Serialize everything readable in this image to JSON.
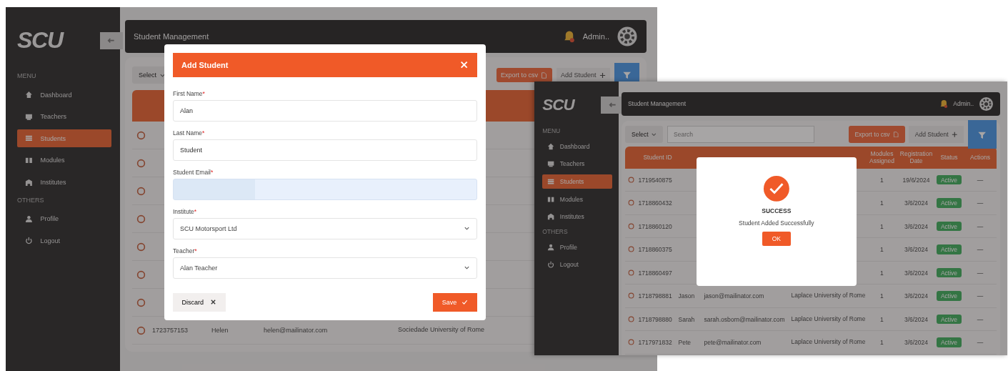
{
  "screens": [
    {
      "sidebar": {
        "logo": "SCU",
        "sections": [
          {
            "label": "MENU",
            "items": [
              {
                "label": "Dashboard",
                "selected": false
              },
              {
                "label": "Teachers",
                "selected": false
              },
              {
                "label": "Students",
                "selected": true
              },
              {
                "label": "Modules",
                "selected": false
              },
              {
                "label": "Institutes",
                "selected": false
              }
            ]
          },
          {
            "label": "OTHERS",
            "items": [
              {
                "label": "Profile",
                "selected": false
              },
              {
                "label": "Logout",
                "selected": false
              }
            ]
          }
        ]
      },
      "header": {
        "title": "Student Management",
        "user": "Admin.."
      },
      "toolbar": {
        "select": "Select",
        "export": "Export to csv",
        "add": "Add Student"
      },
      "table": {
        "rows": [
          {},
          {},
          {},
          {},
          {},
          {},
          {},
          {
            "id": "1723757153",
            "name": "Helen",
            "email": "helen@mailinator.com",
            "institute": "Sociedade University of Rome"
          }
        ]
      },
      "dialog": {
        "kind": "form",
        "title": "Add Student",
        "fields": [
          {
            "kind": "text",
            "label": "First Name",
            "required_mark": "*",
            "value": "Alan",
            "autofilled": false
          },
          {
            "kind": "text",
            "label": "Last Name",
            "required_mark": "*",
            "value": "Student",
            "autofilled": false
          },
          {
            "kind": "text",
            "label": "Student Email",
            "required_mark": "*",
            "autofilled": true
          },
          {
            "kind": "select",
            "label": "Institute",
            "required_mark": "*",
            "value": "SCU Motorsport Ltd"
          },
          {
            "kind": "select",
            "label": "Teacher",
            "required_mark": "*",
            "value": "Alan Teacher"
          }
        ],
        "discard": "Discard",
        "save": "Save"
      }
    },
    {
      "sidebar": {
        "logo": "SCU",
        "sections": [
          {
            "label": "MENU",
            "items": [
              {
                "label": "Dashboard",
                "selected": false
              },
              {
                "label": "Teachers",
                "selected": false
              },
              {
                "label": "Students",
                "selected": true
              },
              {
                "label": "Modules",
                "selected": false
              },
              {
                "label": "Institutes",
                "selected": false
              }
            ]
          },
          {
            "label": "OTHERS",
            "items": [
              {
                "label": "Profile",
                "selected": false
              },
              {
                "label": "Logout",
                "selected": false
              }
            ]
          }
        ]
      },
      "header": {
        "title": "Student Management",
        "user": "Admin.."
      },
      "toolbar": {
        "select": "Select",
        "search": {
          "placeholder": "Search"
        },
        "export": "Export to csv",
        "add": "Add Student"
      },
      "table": {
        "header": {
          "id": "Student ID",
          "modules": "Modules Assigned",
          "date": "Registration Date",
          "status": "Status",
          "actions": "Actions"
        },
        "rows": [
          {
            "id": "1719540875",
            "modules": "1",
            "date": "19/6/2024",
            "status": "Active",
            "actions": "—"
          },
          {
            "id": "1718860432",
            "modules": "1",
            "date": "3/6/2024",
            "status": "Active",
            "actions": "—"
          },
          {
            "id": "1718860120",
            "modules": "1",
            "date": "3/6/2024",
            "status": "Active",
            "actions": "—"
          },
          {
            "id": "1718860375",
            "modules": "1",
            "date": "3/6/2024",
            "status": "Active",
            "actions": "—"
          },
          {
            "id": "1718860497",
            "modules": "1",
            "date": "3/6/2024",
            "status": "Active",
            "actions": "—"
          },
          {
            "id": "1718798881",
            "name": "Jason",
            "email": "jason@mailinator.com",
            "institute": "Laplace University of Rome",
            "modules": "1",
            "date": "3/6/2024",
            "status": "Active",
            "actions": "—"
          },
          {
            "id": "1718798880",
            "name": "Sarah",
            "email": "sarah.osborn@mailinator.com",
            "institute": "Laplace University of Rome",
            "modules": "1",
            "date": "3/6/2024",
            "status": "Active",
            "actions": "—"
          },
          {
            "id": "1717971832",
            "name": "Pete",
            "email": "pete@mailinator.com",
            "institute": "Laplace University of Rome",
            "modules": "1",
            "date": "3/6/2024",
            "status": "Active",
            "actions": "—"
          }
        ]
      },
      "dialog": {
        "kind": "alert",
        "title": "SUCCESS",
        "message": "Student Added Successfully",
        "ok": "OK"
      }
    }
  ]
}
